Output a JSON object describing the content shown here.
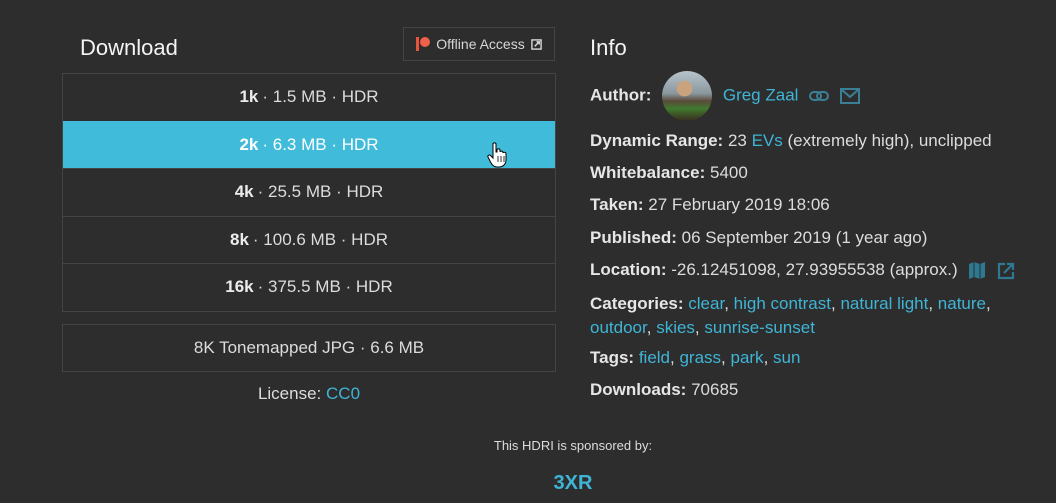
{
  "download": {
    "title": "Download",
    "offline_access_label": "Offline Access",
    "resolutions": [
      {
        "res": "1k",
        "detail": "· 1.5 MB · HDR",
        "active": false
      },
      {
        "res": "2k",
        "detail": "· 6.3 MB · HDR",
        "active": true
      },
      {
        "res": "4k",
        "detail": "· 25.5 MB · HDR",
        "active": false
      },
      {
        "res": "8k",
        "detail": "· 100.6 MB · HDR",
        "active": false
      },
      {
        "res": "16k",
        "detail": "· 375.5 MB · HDR",
        "active": false
      }
    ],
    "tonemapped": "8K Tonemapped JPG · 6.6 MB",
    "license_label": "License:",
    "license_value": "CC0"
  },
  "info": {
    "title": "Info",
    "author_label": "Author:",
    "author_name": "Greg Zaal",
    "dynamic_range_label": "Dynamic Range:",
    "dynamic_range_num": "23",
    "dynamic_range_link": "EVs",
    "dynamic_range_rest": "(extremely high), unclipped",
    "whitebalance_label": "Whitebalance:",
    "whitebalance_value": "5400",
    "taken_label": "Taken:",
    "taken_value": "27 February 2019 18:06",
    "published_label": "Published:",
    "published_value": "06 September 2019 (1 year ago)",
    "location_label": "Location:",
    "location_value": "-26.12451098, 27.93955538 (approx.)",
    "categories_label": "Categories:",
    "categories": [
      "clear",
      "high contrast",
      "natural light",
      "nature",
      "outdoor",
      "skies",
      "sunrise-sunset"
    ],
    "tags_label": "Tags:",
    "tags": [
      "field",
      "grass",
      "park",
      "sun"
    ],
    "downloads_label": "Downloads:",
    "downloads_value": "70685"
  },
  "sponsor": {
    "text": "This HDRI is sponsored by:",
    "name": "3XR"
  },
  "colors": {
    "accent": "#40bcda",
    "link": "#3fb5d6",
    "background": "#2d2d2d",
    "patreon": "#f0604a"
  }
}
